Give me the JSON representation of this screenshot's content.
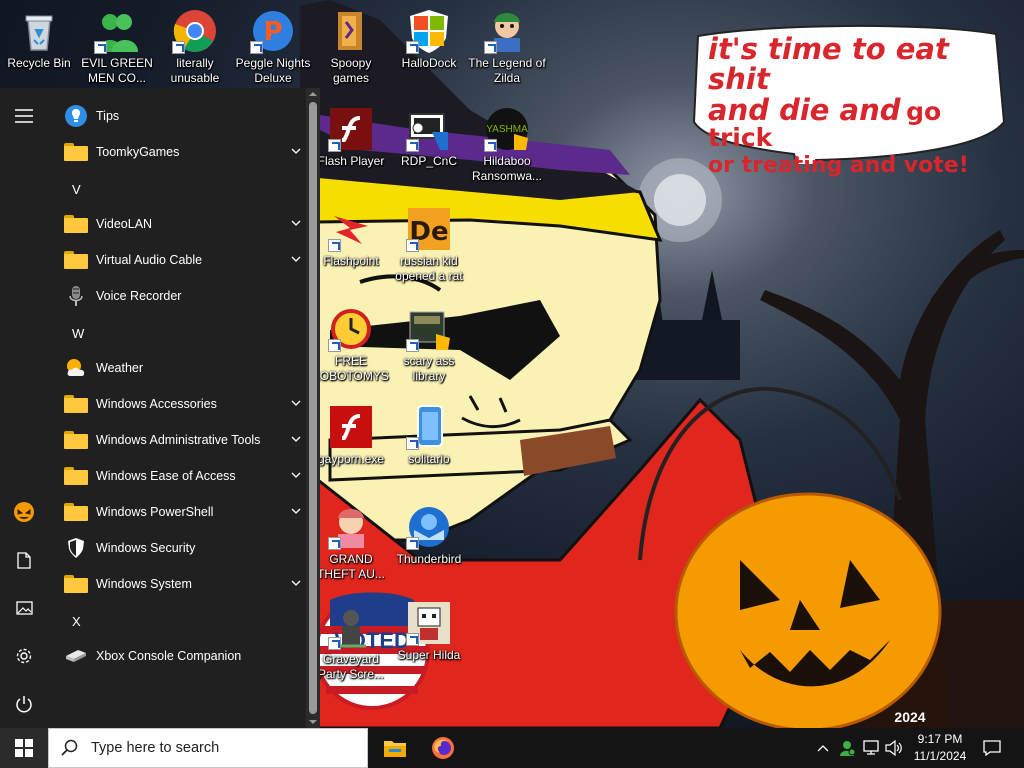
{
  "wallpaper": {
    "speech_bubble": {
      "line1": "it's time to eat shit",
      "line2a": "and die and",
      "line2b": "go trick",
      "line3": "or treating and vote!"
    },
    "sticker_text": "VOTED",
    "corner_text": "2024"
  },
  "desktop_icons": [
    {
      "label": "Recycle Bin",
      "icon": "recycle-bin-icon"
    },
    {
      "label": "EVIL GREEN MEN CO...",
      "icon": "green-men-icon"
    },
    {
      "label": "literally unusable",
      "icon": "chrome-icon"
    },
    {
      "label": "Peggle Nights Deluxe",
      "icon": "peggle-icon"
    },
    {
      "label": "Spoopy games",
      "icon": "folder-icon"
    },
    {
      "label": "HalloDock",
      "icon": "windows-shield-icon"
    },
    {
      "label": "The Legend of Zilda",
      "icon": "zilda-icon"
    },
    {
      "label": "Flash Player",
      "icon": "flash-icon"
    },
    {
      "label": "RDP_CnC",
      "icon": "rdp-icon"
    },
    {
      "label": "Hildaboo Ransomwa...",
      "icon": "yashma-icon"
    },
    {
      "label": "Flashpoint",
      "icon": "flashpoint-icon"
    },
    {
      "label": "russian kid opened a rat",
      "icon": "de-icon"
    },
    {
      "label": "FREE LOBOTOMYS",
      "icon": "clock-icon"
    },
    {
      "label": "scary ass library",
      "icon": "library-icon"
    },
    {
      "label": "gayporn.exe",
      "icon": "flash-icon"
    },
    {
      "label": "solitario",
      "icon": "solitaire-icon"
    },
    {
      "label": "GRAND THEFT AU...",
      "icon": "gta-icon"
    },
    {
      "label": "Thunderbird",
      "icon": "thunderbird-icon"
    },
    {
      "label": "Graveyard Party Scre...",
      "icon": "graveyard-icon"
    },
    {
      "label": "Super Hilda",
      "icon": "hilda-icon"
    }
  ],
  "start_menu": {
    "rail": [
      "hamburger-menu-icon",
      "user-avatar-icon",
      "documents-icon",
      "pictures-icon",
      "settings-icon",
      "power-icon"
    ],
    "items": [
      {
        "type": "app",
        "label": "Tips",
        "icon": "tips-icon"
      },
      {
        "type": "folder",
        "label": "ToomkyGames"
      },
      {
        "type": "letter",
        "label": "V"
      },
      {
        "type": "folder",
        "label": "VideoLAN"
      },
      {
        "type": "folder",
        "label": "Virtual Audio Cable"
      },
      {
        "type": "app",
        "label": "Voice Recorder",
        "icon": "microphone-icon"
      },
      {
        "type": "letter",
        "label": "W"
      },
      {
        "type": "app",
        "label": "Weather",
        "icon": "weather-icon"
      },
      {
        "type": "folder",
        "label": "Windows Accessories"
      },
      {
        "type": "folder",
        "label": "Windows Administrative Tools"
      },
      {
        "type": "folder",
        "label": "Windows Ease of Access"
      },
      {
        "type": "folder",
        "label": "Windows PowerShell"
      },
      {
        "type": "app",
        "label": "Windows Security",
        "icon": "shield-icon"
      },
      {
        "type": "folder",
        "label": "Windows System"
      },
      {
        "type": "letter",
        "label": "X"
      },
      {
        "type": "app",
        "label": "Xbox Console Companion",
        "icon": "xbox-console-icon"
      }
    ]
  },
  "taskbar": {
    "search_placeholder": "Type here to search",
    "pinned": [
      "file-explorer-icon",
      "firefox-icon"
    ],
    "tray": [
      "chevron-up-icon",
      "user-people-icon",
      "network-icon",
      "volume-icon"
    ],
    "time": "9:17 PM",
    "date": "11/1/2024",
    "notification_icon": "action-center-icon"
  }
}
